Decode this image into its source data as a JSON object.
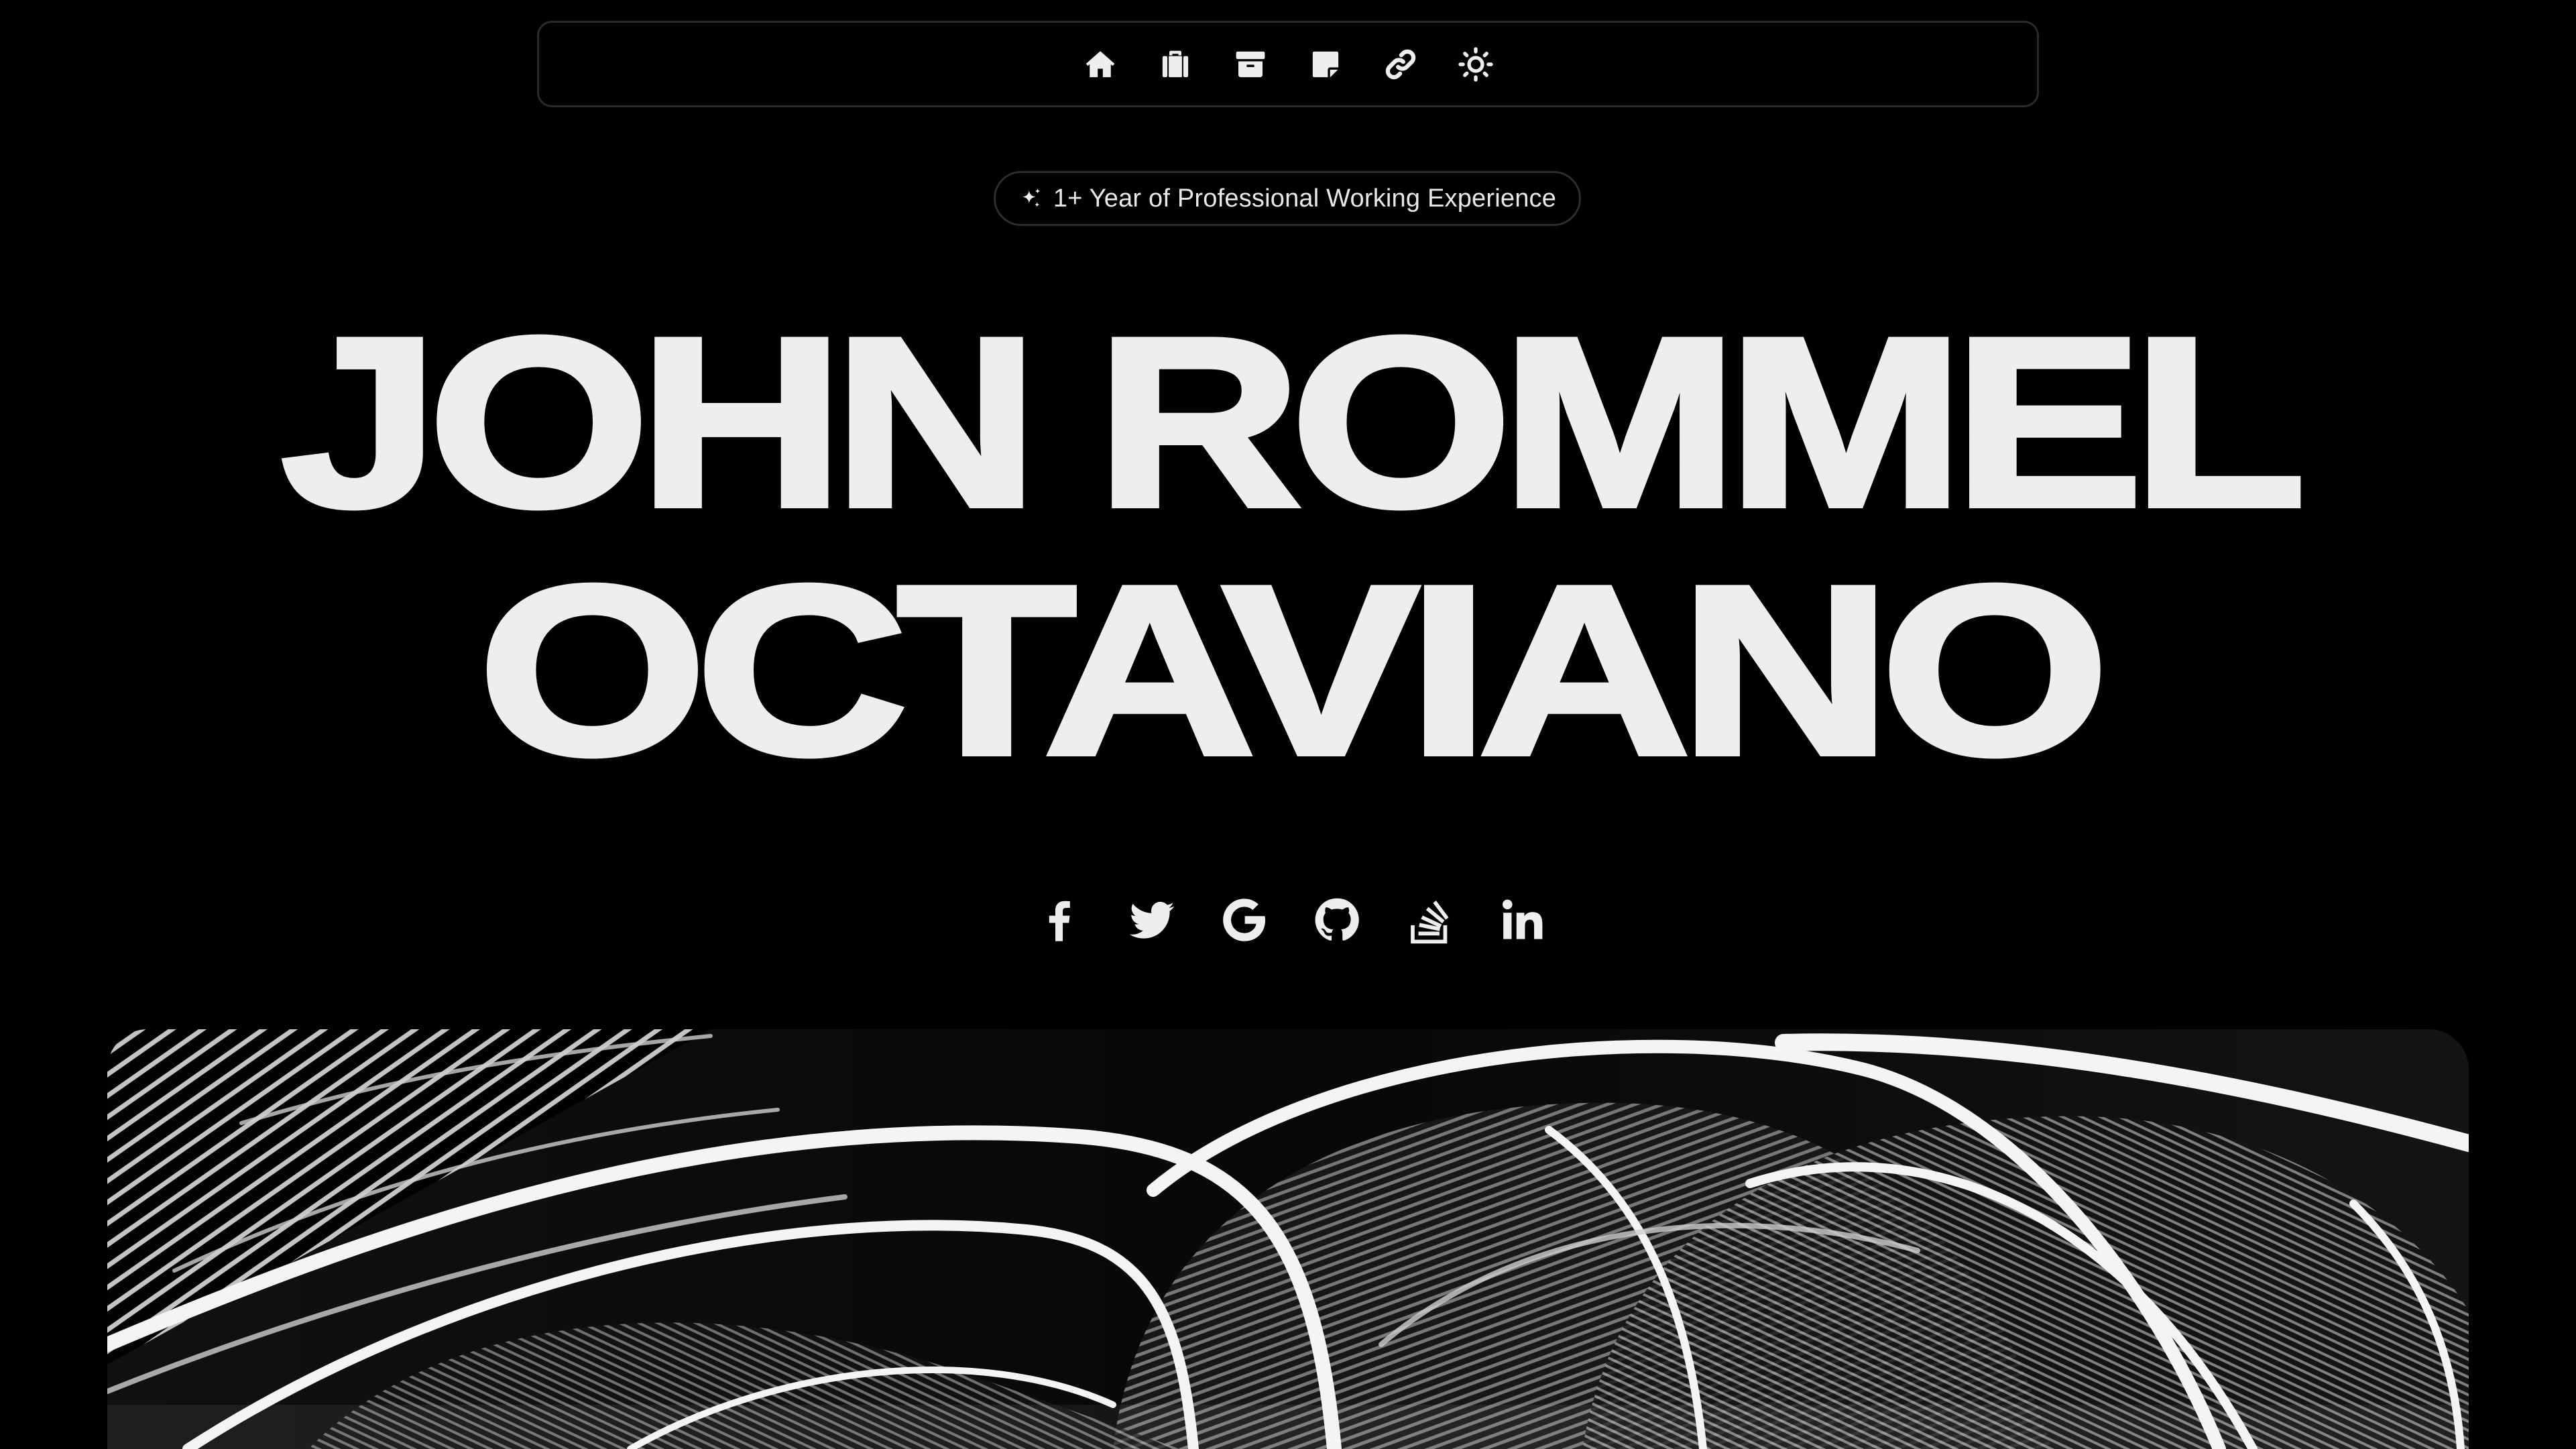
{
  "nav": {
    "items": [
      {
        "id": "home",
        "icon": "home-icon"
      },
      {
        "id": "work",
        "icon": "briefcase-icon"
      },
      {
        "id": "projects",
        "icon": "archive-box-icon"
      },
      {
        "id": "notes",
        "icon": "sticky-note-icon"
      },
      {
        "id": "links",
        "icon": "link-icon"
      },
      {
        "id": "theme",
        "icon": "sun-icon"
      }
    ]
  },
  "badge": {
    "icon": "sparkles-icon",
    "text": "1+ Year of Professional Working Experience"
  },
  "hero": {
    "line1": "JOHN ROMMEL",
    "line2": "OCTAVIANO"
  },
  "socials": [
    {
      "id": "facebook",
      "icon": "facebook-icon"
    },
    {
      "id": "twitter",
      "icon": "twitter-icon"
    },
    {
      "id": "google",
      "icon": "google-icon"
    },
    {
      "id": "github",
      "icon": "github-icon"
    },
    {
      "id": "stackoverflow",
      "icon": "stackoverflow-icon"
    },
    {
      "id": "linkedin",
      "icon": "linkedin-icon"
    }
  ],
  "colors": {
    "background": "#000000",
    "text": "#eceef0",
    "border": "#2a2a2c"
  }
}
